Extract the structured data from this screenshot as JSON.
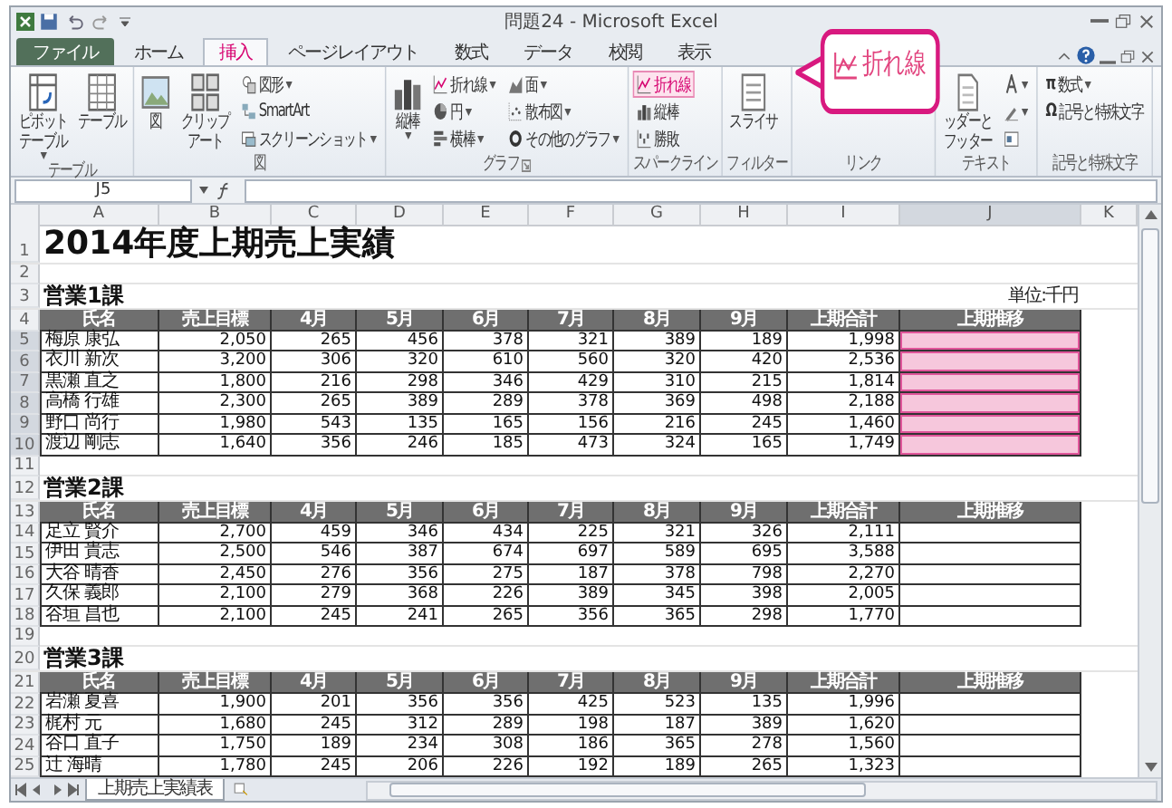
{
  "window": {
    "title": "問題24 - Microsoft Excel"
  },
  "ribbon_tabs": [
    {
      "label": "ファイル",
      "kind": "file",
      "selected": false
    },
    {
      "label": "ホーム",
      "kind": "tab",
      "selected": false
    },
    {
      "label": "挿入",
      "kind": "tab",
      "selected": true
    },
    {
      "label": "ページレイアウト",
      "kind": "tab",
      "selected": false
    },
    {
      "label": "数式",
      "kind": "tab",
      "selected": false
    },
    {
      "label": "データ",
      "kind": "tab",
      "selected": false
    },
    {
      "label": "校閲",
      "kind": "tab",
      "selected": false
    },
    {
      "label": "表示",
      "kind": "tab",
      "selected": false
    }
  ],
  "ribbon_groups": [
    {
      "label": "テーブル",
      "items": [
        {
          "label": "ピボットテーブル",
          "kind": "large",
          "dropdown": true,
          "highlighted": false
        },
        {
          "label": "テーブル",
          "kind": "large",
          "dropdown": false,
          "highlighted": false
        }
      ]
    },
    {
      "label": "図",
      "items": [
        {
          "label": "図",
          "kind": "large",
          "dropdown": false,
          "highlighted": false
        },
        {
          "label": "クリップアート",
          "kind": "large",
          "dropdown": false,
          "highlighted": false
        },
        {
          "label": "図形",
          "kind": "small",
          "dropdown": true,
          "highlighted": false
        },
        {
          "label": "SmartArt",
          "kind": "small",
          "dropdown": false,
          "highlighted": false
        },
        {
          "label": "スクリーンショット",
          "kind": "small",
          "dropdown": true,
          "highlighted": false
        }
      ]
    },
    {
      "label": "グラフ",
      "launcher": true,
      "items": [
        {
          "label": "縦棒",
          "kind": "large",
          "dropdown": true,
          "highlighted": false
        },
        {
          "label": "折れ線",
          "kind": "small",
          "dropdown": true,
          "highlighted": false
        },
        {
          "label": "円",
          "kind": "small",
          "dropdown": true,
          "highlighted": false
        },
        {
          "label": "横棒",
          "kind": "small",
          "dropdown": true,
          "highlighted": false
        },
        {
          "label": "面",
          "kind": "small",
          "dropdown": true,
          "highlighted": false
        },
        {
          "label": "散布図",
          "kind": "small",
          "dropdown": true,
          "highlighted": false
        },
        {
          "label": "その他のグラフ",
          "kind": "small",
          "dropdown": true,
          "highlighted": false
        }
      ]
    },
    {
      "label": "スパークライン",
      "items": [
        {
          "label": "折れ線",
          "kind": "small",
          "dropdown": false,
          "highlighted": true
        },
        {
          "label": "縦棒",
          "kind": "small",
          "dropdown": false,
          "highlighted": false
        },
        {
          "label": "勝敗",
          "kind": "small",
          "dropdown": false,
          "highlighted": false
        }
      ]
    },
    {
      "label": "フィルター",
      "items": [
        {
          "label": "スライサ",
          "kind": "large",
          "dropdown": false,
          "highlighted": false
        }
      ]
    },
    {
      "label": "リンク",
      "callout": {
        "label": "折れ線"
      }
    },
    {
      "label": "テキスト",
      "items": [
        {
          "label": "ッダーとフッター",
          "kind": "large",
          "dropdown": false,
          "highlighted": false
        },
        {
          "kind": "small",
          "dropdown": true,
          "highlighted": false
        },
        {
          "kind": "small",
          "dropdown": true,
          "highlighted": false
        },
        {
          "kind": "small",
          "dropdown": false,
          "highlighted": false
        }
      ]
    },
    {
      "label": "記号と特殊文字",
      "items": [
        {
          "label": "数式",
          "glyph": "π",
          "kind": "small",
          "dropdown": true,
          "highlighted": false
        },
        {
          "label": "記号と特殊文字",
          "glyph": "Ω",
          "kind": "small",
          "dropdown": false,
          "highlighted": false
        }
      ]
    }
  ],
  "formula_bar": {
    "name_box": "J5"
  },
  "sheet": {
    "columns": [
      {
        "label": "A",
        "selected": false
      },
      {
        "label": "B",
        "selected": false
      },
      {
        "label": "C",
        "selected": false
      },
      {
        "label": "D",
        "selected": false
      },
      {
        "label": "E",
        "selected": false
      },
      {
        "label": "F",
        "selected": false
      },
      {
        "label": "G",
        "selected": false
      },
      {
        "label": "H",
        "selected": false
      },
      {
        "label": "I",
        "selected": false
      },
      {
        "label": "J",
        "selected": true
      },
      {
        "label": "K",
        "selected": false
      }
    ],
    "rows": [
      {
        "number": "1",
        "kind": "title",
        "text": "2014年度上期売上実績"
      },
      {
        "number": "2",
        "kind": "blank"
      },
      {
        "number": "3",
        "kind": "section",
        "text": "営業1課",
        "note": "単位:千円"
      },
      {
        "number": "4",
        "kind": "header",
        "cells": [
          "氏名",
          "売上目標",
          "4月",
          "5月",
          "6月",
          "7月",
          "8月",
          "9月",
          "上期合計",
          "上期推移"
        ]
      },
      {
        "number": "5",
        "kind": "data",
        "selected": true,
        "cells": [
          "梅原 康弘",
          "2,050",
          "265",
          "456",
          "378",
          "321",
          "389",
          "189",
          "1,998"
        ]
      },
      {
        "number": "6",
        "kind": "data",
        "selected": true,
        "cells": [
          "衣川 新次",
          "3,200",
          "306",
          "320",
          "610",
          "560",
          "320",
          "420",
          "2,536"
        ]
      },
      {
        "number": "7",
        "kind": "data",
        "selected": true,
        "cells": [
          "黒瀬 直之",
          "1,800",
          "216",
          "298",
          "346",
          "429",
          "310",
          "215",
          "1,814"
        ]
      },
      {
        "number": "8",
        "kind": "data",
        "selected": true,
        "cells": [
          "高橋 行雄",
          "2,300",
          "265",
          "389",
          "289",
          "378",
          "369",
          "498",
          "2,188"
        ]
      },
      {
        "number": "9",
        "kind": "data",
        "selected": true,
        "cells": [
          "野口 尚行",
          "1,980",
          "543",
          "135",
          "165",
          "156",
          "216",
          "245",
          "1,460"
        ]
      },
      {
        "number": "10",
        "kind": "data",
        "selected": true,
        "cells": [
          "渡辺 剛志",
          "1,640",
          "356",
          "246",
          "185",
          "473",
          "324",
          "165",
          "1,749"
        ]
      },
      {
        "number": "11",
        "kind": "blank"
      },
      {
        "number": "12",
        "kind": "section",
        "text": "営業2課"
      },
      {
        "number": "13",
        "kind": "header",
        "cells": [
          "氏名",
          "売上目標",
          "4月",
          "5月",
          "6月",
          "7月",
          "8月",
          "9月",
          "上期合計",
          "上期推移"
        ]
      },
      {
        "number": "14",
        "kind": "data",
        "selected": false,
        "cells": [
          "足立 賢介",
          "2,700",
          "459",
          "346",
          "434",
          "225",
          "321",
          "326",
          "2,111"
        ]
      },
      {
        "number": "15",
        "kind": "data",
        "selected": false,
        "cells": [
          "伊田 貴志",
          "2,500",
          "546",
          "387",
          "674",
          "697",
          "589",
          "695",
          "3,588"
        ]
      },
      {
        "number": "16",
        "kind": "data",
        "selected": false,
        "cells": [
          "大谷 晴香",
          "2,450",
          "276",
          "356",
          "275",
          "187",
          "378",
          "798",
          "2,270"
        ]
      },
      {
        "number": "17",
        "kind": "data",
        "selected": false,
        "cells": [
          "久保 義郎",
          "2,100",
          "279",
          "368",
          "226",
          "389",
          "345",
          "398",
          "2,005"
        ]
      },
      {
        "number": "18",
        "kind": "data",
        "selected": false,
        "cells": [
          "谷垣 昌也",
          "2,100",
          "245",
          "241",
          "265",
          "356",
          "365",
          "298",
          "1,770"
        ]
      },
      {
        "number": "19",
        "kind": "blank"
      },
      {
        "number": "20",
        "kind": "section",
        "text": "営業3課"
      },
      {
        "number": "21",
        "kind": "header",
        "cells": [
          "氏名",
          "売上目標",
          "4月",
          "5月",
          "6月",
          "7月",
          "8月",
          "9月",
          "上期合計",
          "上期推移"
        ]
      },
      {
        "number": "22",
        "kind": "data",
        "selected": false,
        "cells": [
          "岩瀬 夏喜",
          "1,900",
          "201",
          "356",
          "356",
          "425",
          "523",
          "135",
          "1,996"
        ]
      },
      {
        "number": "23",
        "kind": "data",
        "selected": false,
        "cells": [
          "梶村 元",
          "1,680",
          "245",
          "312",
          "289",
          "198",
          "187",
          "389",
          "1,620"
        ]
      },
      {
        "number": "24",
        "kind": "data",
        "selected": false,
        "cells": [
          "谷口 直子",
          "1,750",
          "189",
          "234",
          "308",
          "186",
          "365",
          "278",
          "1,560"
        ]
      },
      {
        "number": "25",
        "kind": "data",
        "selected": false,
        "cells": [
          "辻 海晴",
          "1,780",
          "245",
          "206",
          "226",
          "192",
          "189",
          "265",
          "1,323"
        ]
      }
    ]
  },
  "sheet_tabs": [
    {
      "label": "上期売上実績表",
      "selected": true
    }
  ]
}
